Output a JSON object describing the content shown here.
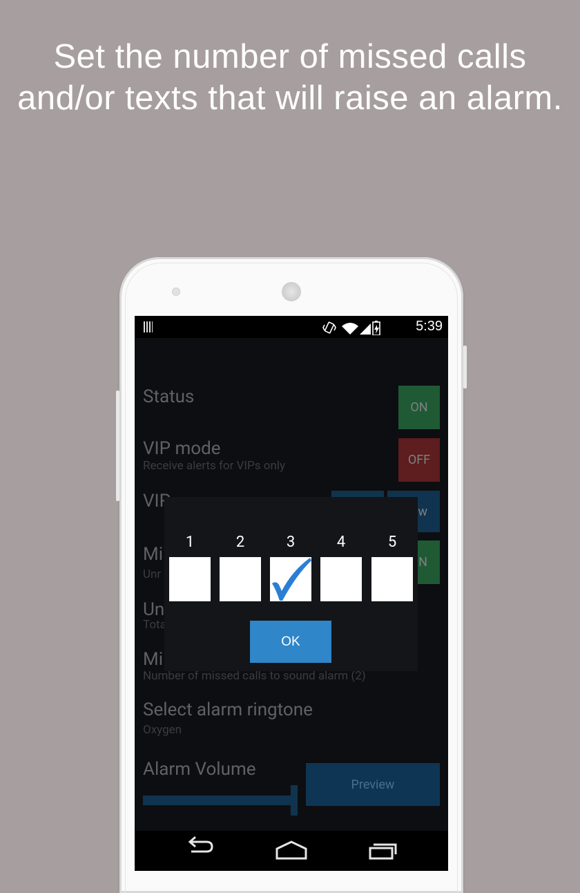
{
  "caption": {
    "line1": "Set the number of missed calls",
    "line2": "and/or texts that will raise an alarm."
  },
  "statusbar": {
    "time": "5:39"
  },
  "settings": {
    "status_title": "Status",
    "status_toggle": "ON",
    "vip_title": "VIP mode",
    "vip_sub": "Receive alerts for VIPs only",
    "vip_toggle": "OFF",
    "vip_options_partial": "VIP",
    "vip_options_button": "w",
    "missed_partial": "Mi",
    "missed_sub_partial": "Unr",
    "missed_toggle_partial": "N",
    "un_partial": "Un",
    "un_sub_partial": "Tota",
    "missed_calls_partial": "Mi",
    "missed_calls_sub": "Number of missed calls to sound alarm (2)",
    "ringtone_title": "Select alarm ringtone",
    "ringtone_sub": "Oxygen",
    "volume_title": "Alarm Volume",
    "preview_button": "Preview"
  },
  "dialog": {
    "options": [
      "1",
      "2",
      "3",
      "4",
      "5"
    ],
    "selected_index": 2,
    "ok_label": "OK"
  },
  "colors": {
    "background": "#a69e9f",
    "on_green": "#1f5a35",
    "off_red": "#5e1d1e",
    "accent_blue": "#2f86c8",
    "check_blue": "#2a7fd4"
  }
}
